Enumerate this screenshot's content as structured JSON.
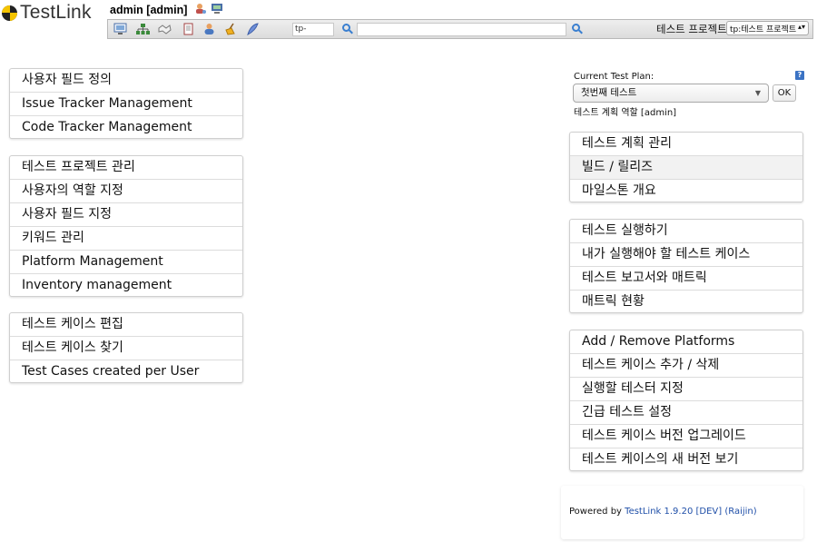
{
  "header": {
    "logo_text": "TestLink",
    "user": "admin [admin]",
    "toolbar_icons": [
      "desktop-icon",
      "sitemap-icon",
      "handshake-icon",
      "document-icon",
      "user-icon",
      "broom-icon",
      "feather-icon"
    ],
    "testcase_search_prefix": "tp-",
    "project_label": "테스트 프로젝트",
    "project_selected": "tp:테스트 프로젝트"
  },
  "left_menus": [
    {
      "items": [
        "사용자 필드 정의",
        "Issue Tracker Management",
        "Code Tracker Management"
      ]
    },
    {
      "items": [
        "테스트 프로젝트 관리",
        "사용자의 역할 지정",
        "사용자 필드 지정",
        "키워드 관리",
        "Platform Management",
        "Inventory management"
      ]
    },
    {
      "items": [
        "테스트 케이스 편집",
        "테스트 케이스 찾기",
        "Test Cases created per User"
      ]
    }
  ],
  "plan": {
    "label": "Current Test Plan:",
    "selected": "첫번째 테스트",
    "ok_label": "OK",
    "role": "테스트 계획 역할 [admin]",
    "help": "?"
  },
  "right_menus": [
    {
      "items": [
        "테스트 계획 관리",
        "빌드 / 릴리즈",
        "마일스톤 개요"
      ]
    },
    {
      "items": [
        "테스트 실행하기",
        "내가 실행해야 할 테스트 케이스",
        "테스트 보고서와 매트릭",
        "매트릭 현황"
      ]
    },
    {
      "items": [
        "Add / Remove Platforms",
        "테스트 케이스 추가 / 삭제",
        "실행할 테스터 지정",
        "긴급 테스트 설정",
        "테스트 케이스 버전 업그레이드",
        "테스트 케이스의 새 버전 보기"
      ]
    }
  ],
  "footer": {
    "powered_by": "Powered by",
    "app_link": "TestLink 1.9.20 [DEV] (Raijin)"
  },
  "colors": {
    "link": "#1f4fa8",
    "logo_accent": "#f5c400"
  }
}
